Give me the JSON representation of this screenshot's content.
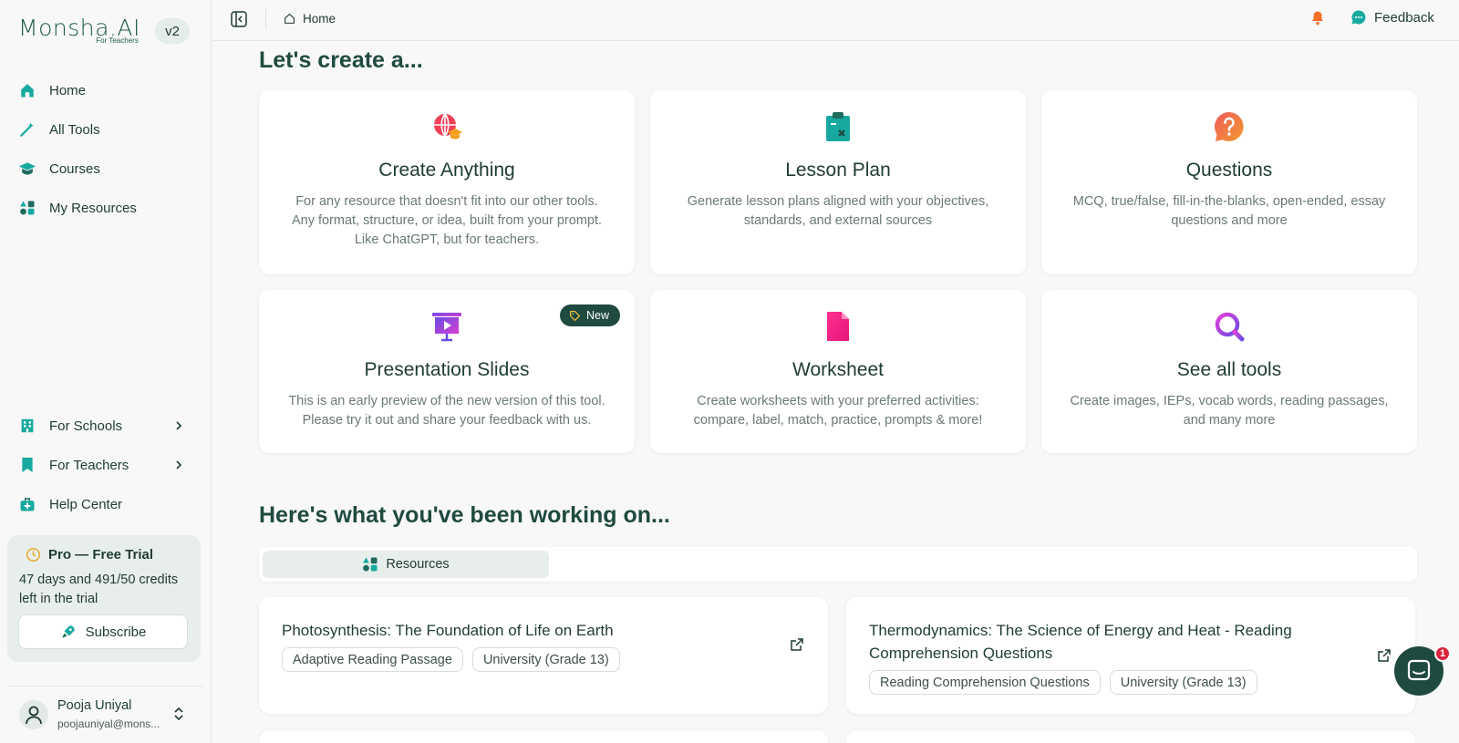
{
  "brand": {
    "name": "Monsha.AI",
    "subtitle": "For Teachers",
    "version": "v2"
  },
  "sidebar": {
    "nav": [
      {
        "label": "Home",
        "icon": "home-icon"
      },
      {
        "label": "All Tools",
        "icon": "magic-wand-icon"
      },
      {
        "label": "Courses",
        "icon": "graduation-cap-icon"
      },
      {
        "label": "My Resources",
        "icon": "shapes-icon"
      }
    ],
    "bottom_nav": [
      {
        "label": "For Schools",
        "icon": "building-icon"
      },
      {
        "label": "For Teachers",
        "icon": "bookmark-icon"
      },
      {
        "label": "Help Center",
        "icon": "medkit-icon"
      }
    ],
    "trial": {
      "title": "Pro — Free Trial",
      "text": "47 days and 491/50 credits left in the trial",
      "subscribe_label": "Subscribe"
    },
    "user": {
      "name": "Pooja Uniyal",
      "email": "poojauniyal@mons..."
    }
  },
  "topbar": {
    "breadcrumb": "Home",
    "feedback_label": "Feedback"
  },
  "main": {
    "create_title": "Let's create a...",
    "tools": [
      {
        "title": "Create Anything",
        "description": "For any resource that doesn't fit into our other tools. Any format, structure, or idea, built from your prompt. Like ChatGPT, but for teachers.",
        "icon": "globe-cap-icon"
      },
      {
        "title": "Lesson Plan",
        "description": "Generate lesson plans aligned with your objectives, standards, and external sources",
        "icon": "clipboard-icon"
      },
      {
        "title": "Questions",
        "description": "MCQ, true/false, fill-in-the-blanks, open-ended, essay questions and more",
        "icon": "question-bubble-icon"
      },
      {
        "title": "Presentation Slides",
        "description": "This is an early preview of the new version of this tool. Please try it out and share your feedback with us.",
        "icon": "presentation-icon",
        "badge": "New"
      },
      {
        "title": "Worksheet",
        "description": "Create worksheets with your preferred activities: compare, label, match, practice, prompts & more!",
        "icon": "document-icon"
      },
      {
        "title": "See all tools",
        "description": "Create images, IEPs, vocab words, reading passages, and many more",
        "icon": "search-icon"
      }
    ],
    "working_title": "Here's what you've been working on...",
    "tabs": [
      {
        "label": "Resources",
        "active": true
      }
    ],
    "resources": [
      {
        "title": "Photosynthesis: The Foundation of Life on Earth",
        "tags": [
          "Adaptive Reading Passage",
          "University (Grade 13)"
        ]
      },
      {
        "title": "Thermodynamics: The Science of Energy and Heat - Reading Comprehension Questions",
        "tags": [
          "Reading Comprehension Questions",
          "University (Grade 13)"
        ]
      }
    ]
  },
  "chat": {
    "unread_count": "1"
  },
  "colors": {
    "accent": "#1f4a40",
    "teal": "#17a9a0",
    "badge_red": "#d7263d"
  }
}
